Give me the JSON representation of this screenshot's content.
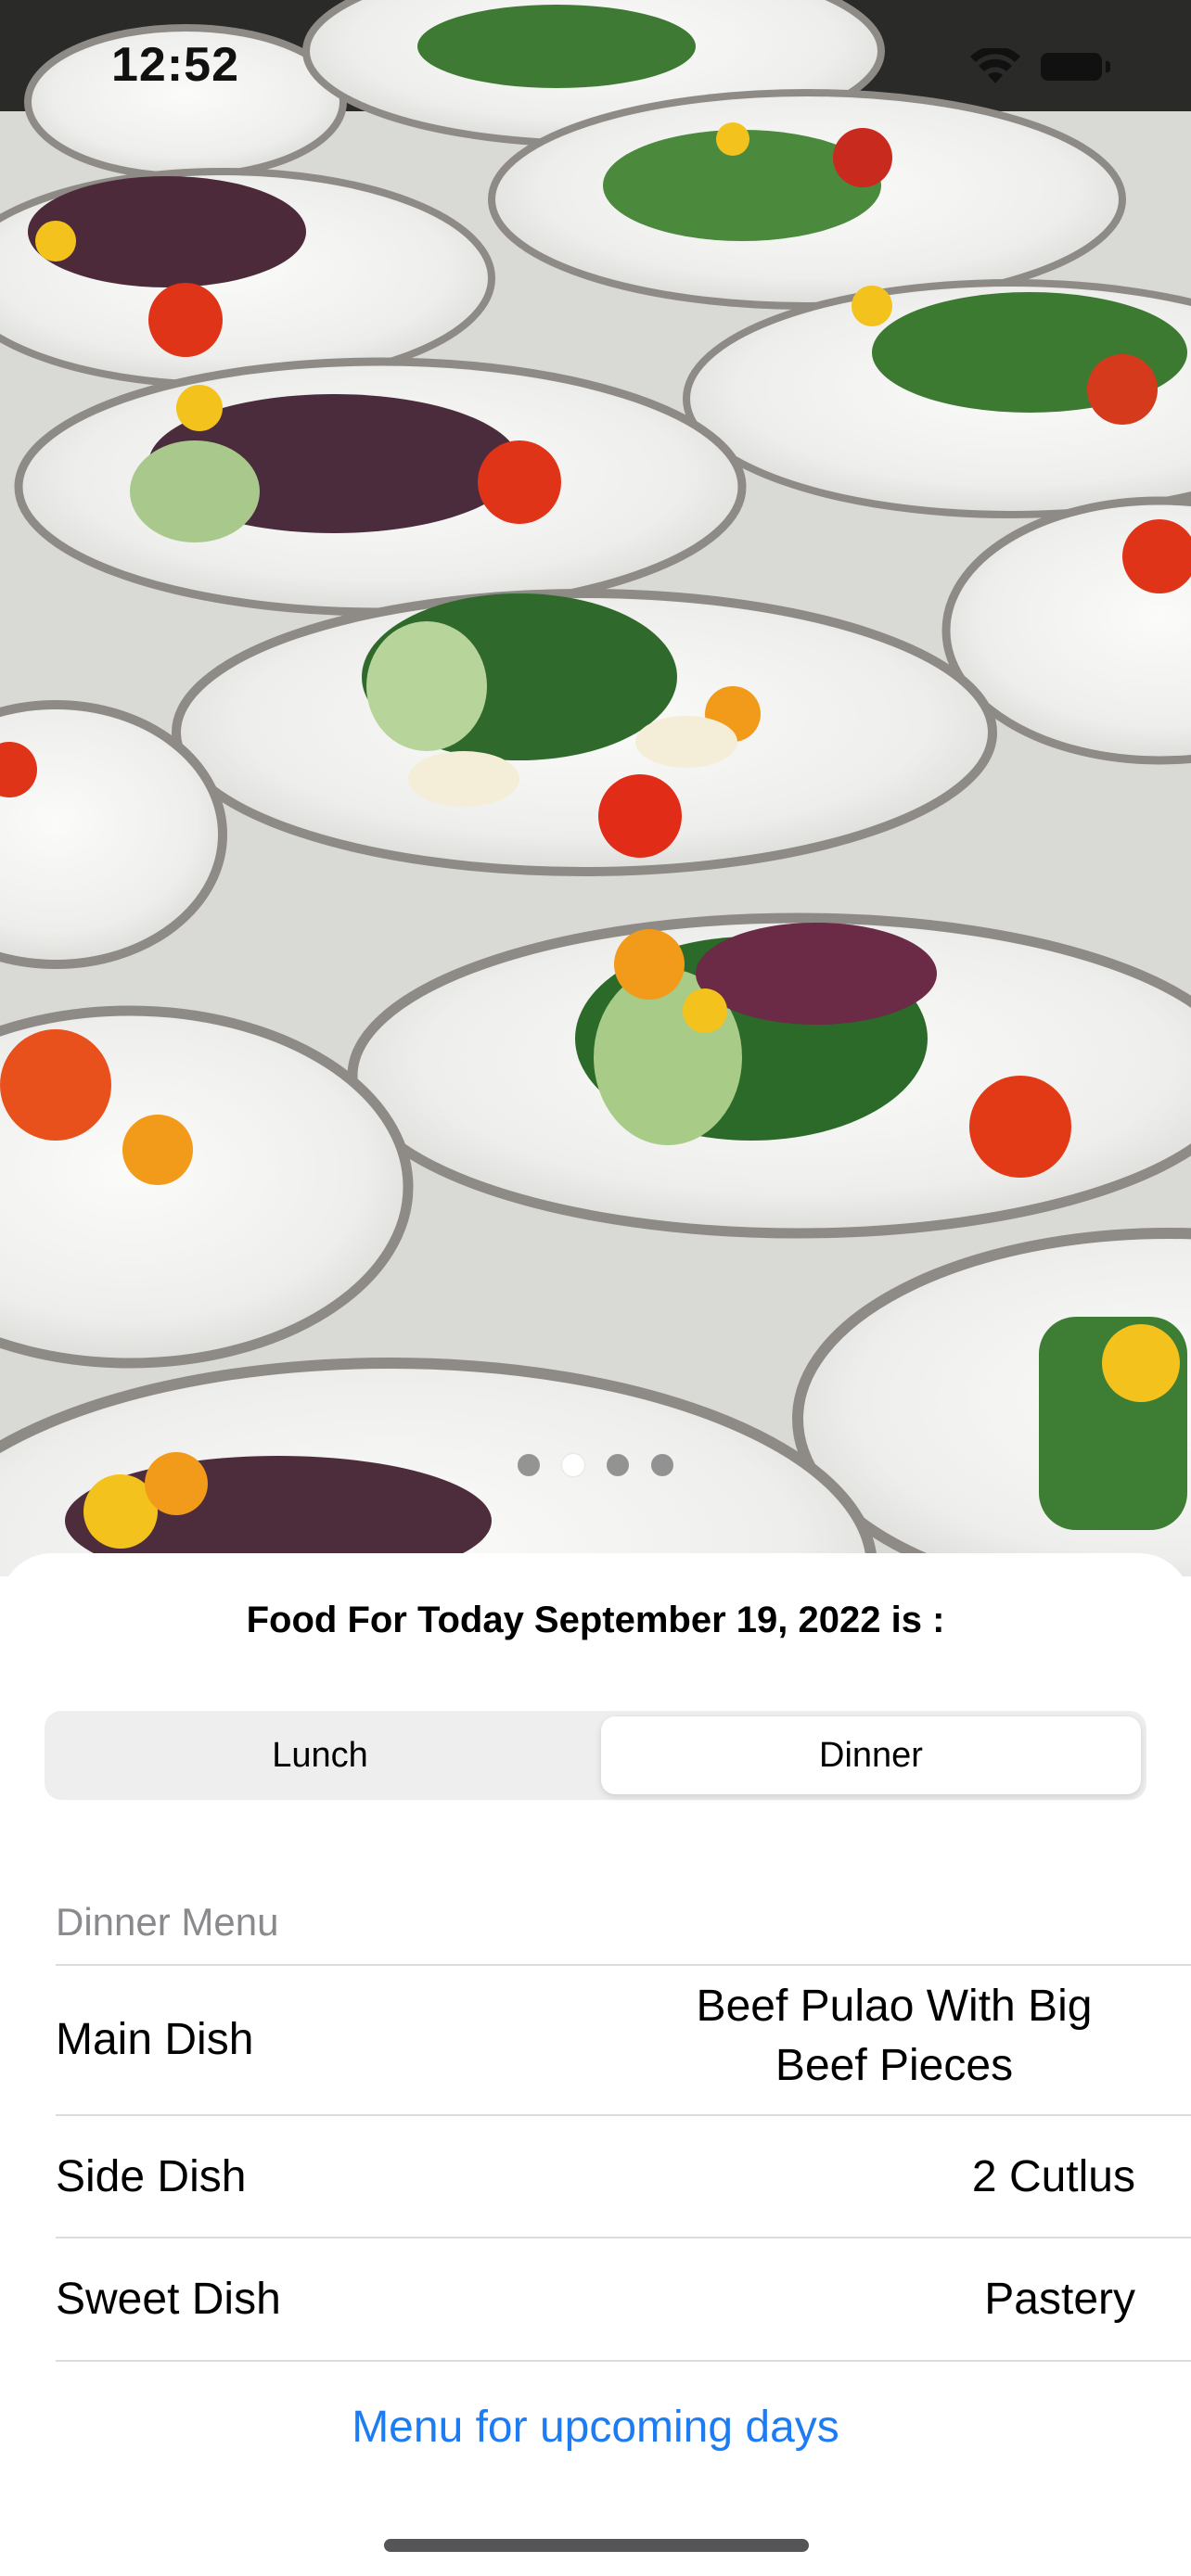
{
  "status_bar": {
    "time": "12:52"
  },
  "carousel": {
    "page_count": 4,
    "active_index": 1
  },
  "header": {
    "title": "Food For Today September 19, 2022 is :"
  },
  "meal_toggle": {
    "options": [
      "Lunch",
      "Dinner"
    ],
    "selected": "Dinner"
  },
  "menu": {
    "section_title": "Dinner Menu",
    "rows": [
      {
        "label": "Main Dish",
        "value": "Beef Pulao With Big Beef Pieces"
      },
      {
        "label": "Side Dish",
        "value": "2 Cutlus"
      },
      {
        "label": "Sweet Dish",
        "value": "Pastery"
      }
    ]
  },
  "footer": {
    "upcoming_link": "Menu for upcoming days"
  },
  "colors": {
    "accent": "#1e7cf2",
    "secondary_text": "#8a8a8e"
  }
}
